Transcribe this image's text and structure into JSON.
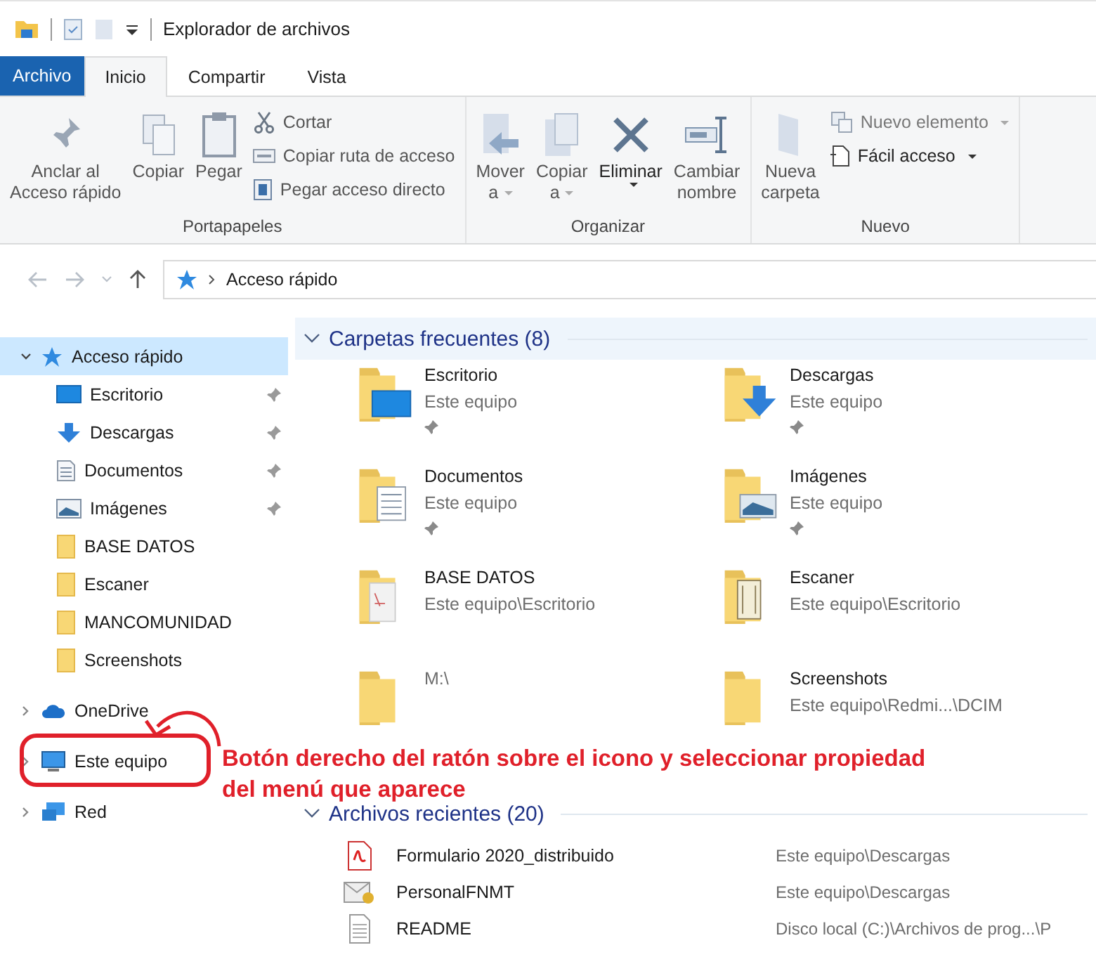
{
  "window": {
    "title": "Explorador de archivos"
  },
  "ribbon_tabs": [
    {
      "label": "Archivo",
      "kind": "file",
      "selected": false
    },
    {
      "label": "Inicio",
      "kind": "tab",
      "selected": true
    },
    {
      "label": "Compartir",
      "kind": "tab",
      "selected": false
    },
    {
      "label": "Vista",
      "kind": "tab",
      "selected": false
    }
  ],
  "ribbon_groups": [
    {
      "label": "Portapapeles",
      "items": [
        {
          "kind": "large",
          "lines": [
            "Anclar al",
            "Acceso rápido"
          ],
          "has_menu": false
        },
        {
          "kind": "large",
          "lines": [
            "Copiar"
          ],
          "has_menu": false
        },
        {
          "kind": "large",
          "lines": [
            "Pegar"
          ],
          "has_menu": false
        },
        {
          "kind": "stack",
          "items": [
            {
              "label": "Cortar",
              "has_menu": false
            },
            {
              "label": "Copiar ruta de acceso",
              "has_menu": false
            },
            {
              "label": "Pegar acceso directo",
              "has_menu": false
            }
          ]
        }
      ]
    },
    {
      "label": "Organizar",
      "items": [
        {
          "kind": "large",
          "lines": [
            "Mover",
            "a"
          ],
          "has_menu": true
        },
        {
          "kind": "large",
          "lines": [
            "Copiar",
            "a"
          ],
          "has_menu": true
        },
        {
          "kind": "large",
          "lines": [
            "Eliminar"
          ],
          "has_menu": true
        },
        {
          "kind": "large",
          "lines": [
            "Cambiar",
            "nombre"
          ],
          "has_menu": false
        }
      ]
    },
    {
      "label": "Nuevo",
      "items": [
        {
          "kind": "large",
          "lines": [
            "Nueva",
            "carpeta"
          ],
          "has_menu": false
        },
        {
          "kind": "stack",
          "items": [
            {
              "label": "Nuevo elemento",
              "has_menu": true
            },
            {
              "label": "Fácil acceso",
              "has_menu": true
            }
          ]
        }
      ]
    }
  ],
  "address_bar": {
    "path": [
      "Acceso rápido"
    ]
  },
  "sidebar": {
    "items": [
      {
        "label": "Acceso rápido",
        "expanded": true,
        "selected": true,
        "children": [
          {
            "label": "Escritorio",
            "pinned": true,
            "selected": false
          },
          {
            "label": "Descargas",
            "pinned": true,
            "selected": false
          },
          {
            "label": "Documentos",
            "pinned": true,
            "selected": false
          },
          {
            "label": "Imágenes",
            "pinned": true,
            "selected": false
          },
          {
            "label": "BASE DATOS",
            "pinned": false,
            "selected": false
          },
          {
            "label": "Escaner",
            "pinned": false,
            "selected": false
          },
          {
            "label": "MANCOMUNIDAD",
            "pinned": false,
            "selected": false
          },
          {
            "label": "Screenshots",
            "pinned": false,
            "selected": false
          }
        ]
      },
      {
        "label": "OneDrive",
        "expanded": false,
        "selected": false
      },
      {
        "label": "Este equipo",
        "expanded": false,
        "selected": false
      },
      {
        "label": "Red",
        "expanded": false,
        "selected": false
      }
    ]
  },
  "frequent_folders": {
    "title": "Carpetas frecuentes (8)",
    "expanded": true,
    "items": [
      {
        "name": "Escritorio",
        "location": "Este equipo",
        "pinned": true
      },
      {
        "name": "Descargas",
        "location": "Este equipo",
        "pinned": true
      },
      {
        "name": "Documentos",
        "location": "Este equipo",
        "pinned": true
      },
      {
        "name": "Imágenes",
        "location": "Este equipo",
        "pinned": true
      },
      {
        "name": "BASE DATOS",
        "location": "Este equipo\\Escritorio",
        "pinned": false
      },
      {
        "name": "Escaner",
        "location": "Este equipo\\Escritorio",
        "pinned": false
      },
      {
        "location": "M:\\",
        "pinned": false
      },
      {
        "name": "Screenshots",
        "location": "Este equipo\\Redmi...\\DCIM",
        "pinned": false
      }
    ]
  },
  "recent_files": {
    "title": "Archivos recientes (20)",
    "expanded": true,
    "items": [
      {
        "name": "Formulario 2020_distribuido",
        "location": "Este equipo\\Descargas"
      },
      {
        "name": "PersonalFNMT",
        "location": "Este equipo\\Descargas"
      },
      {
        "name": "README",
        "location": "Disco local (C:)\\Archivos de prog...\\P"
      }
    ]
  },
  "annotation": {
    "text": "Botón derecho del ratón sobre el icono y seleccionar propiedad\ndel menú que aparece"
  }
}
